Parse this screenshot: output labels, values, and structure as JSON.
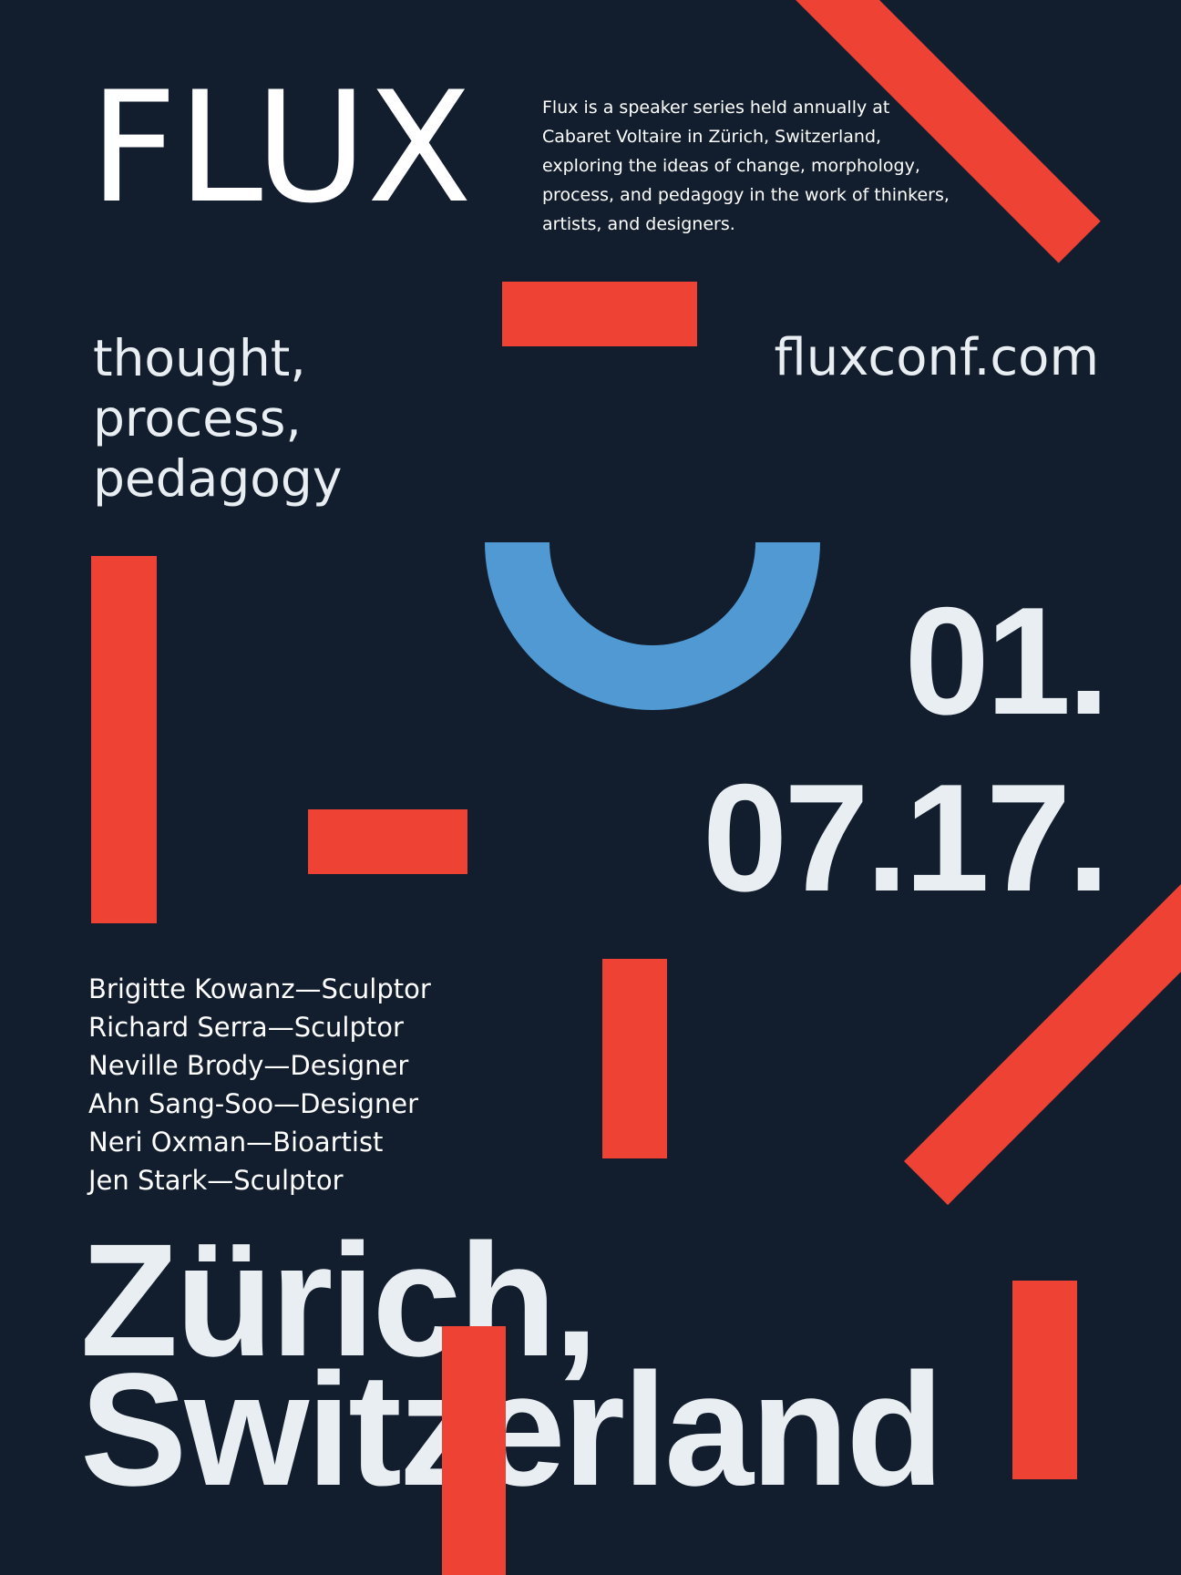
{
  "poster": {
    "logo": "FLUX",
    "description": "Flux is a speaker series held annually at Cabaret Voltaire in Zürich, Switzerland, exploring the ideas of change, morphology, process, and pedagogy in the work of thinkers, artists, and designers.",
    "tagline": [
      "thought,",
      "process,",
      "pedagogy"
    ],
    "url": "fluxconf.com",
    "date": [
      "01.",
      "07.17."
    ],
    "speakers": [
      "Brigitte Kowanz—Sculptor",
      "Richard Serra—Sculptor",
      "Neville Brody—Designer",
      "Ahn Sang-Soo—Designer",
      "Neri Oxman—Bioartist",
      "Jen Stark—Sculptor"
    ],
    "location": [
      "Zürich,",
      "Switzerland"
    ]
  },
  "colors": {
    "background": "#121e2e",
    "accent_red": "#ee4234",
    "accent_blue": "#5099d3",
    "text_light": "#e9eef2"
  },
  "decorations": [
    "red-bar",
    "blue-half-ring"
  ]
}
